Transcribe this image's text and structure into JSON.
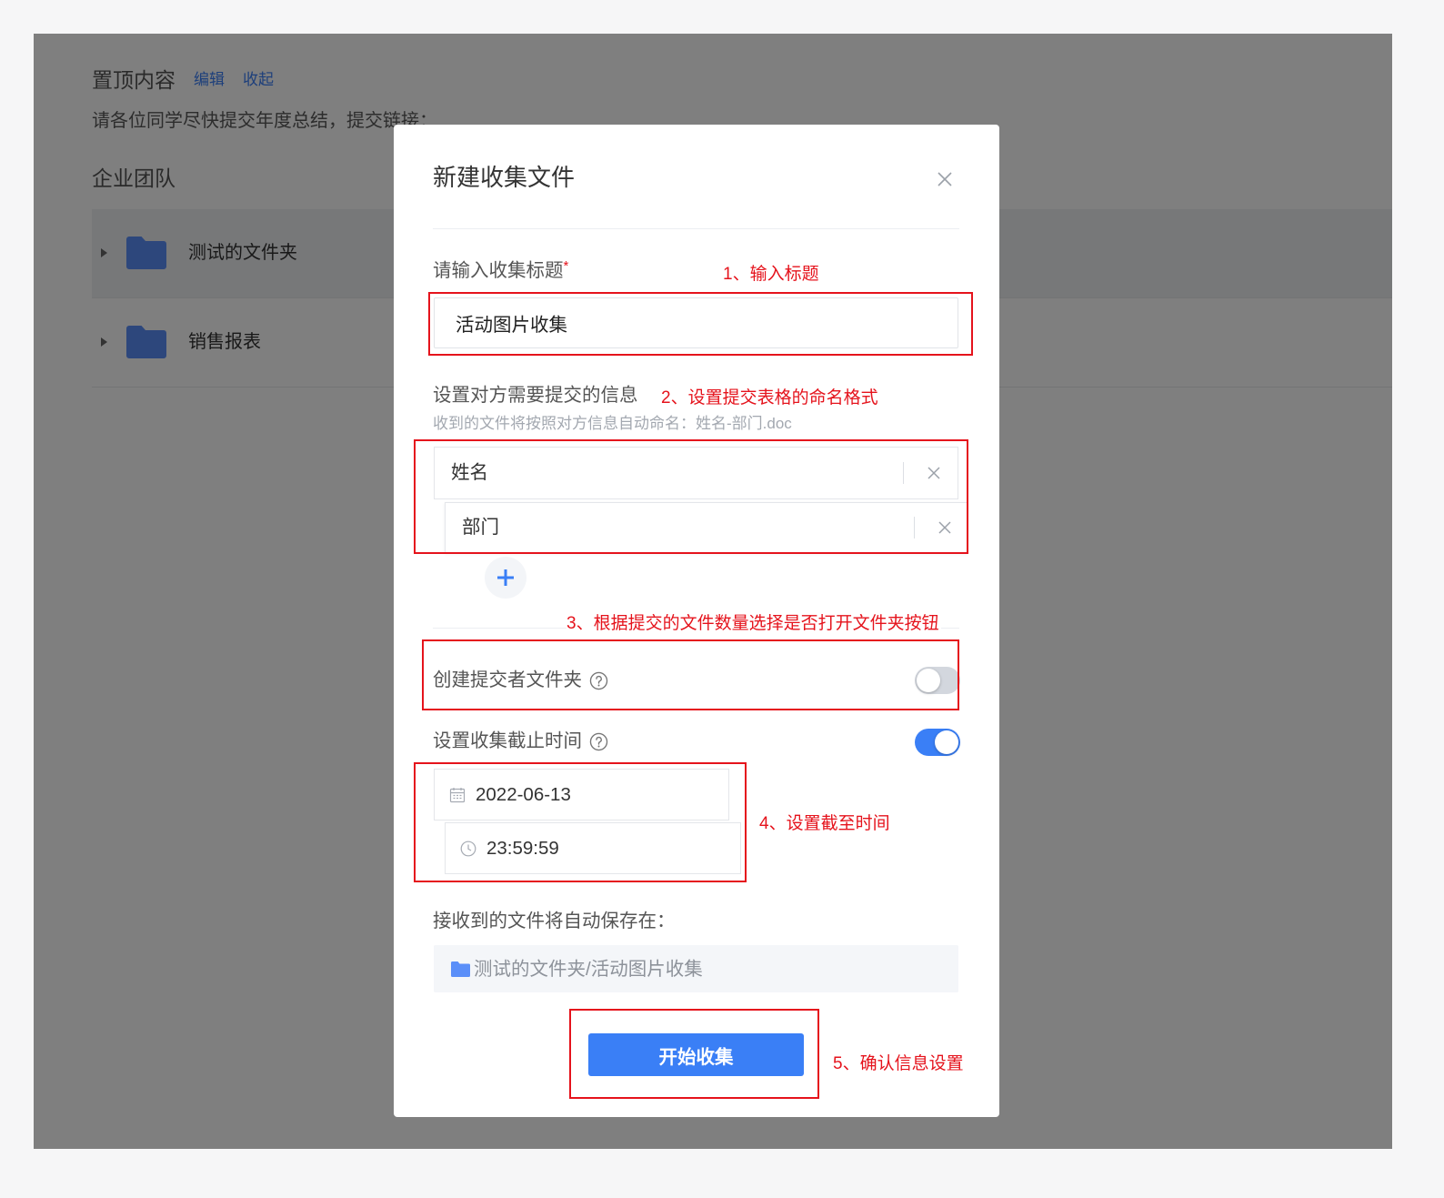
{
  "page": {
    "pinned": {
      "title": "置顶内容",
      "edit_link": "编辑",
      "collapse_link": "收起",
      "text": "请各位同学尽快提交年度总结，提交链接："
    },
    "team_title": "企业团队",
    "folders": [
      {
        "name": "测试的文件夹",
        "hovered": true,
        "icon": "folder-icon"
      },
      {
        "name": "销售报表",
        "hovered": false,
        "icon": "folder-icon"
      }
    ]
  },
  "dialog": {
    "title": "新建收集文件",
    "close_icon": "close-icon",
    "title_field": {
      "label": "请输入收集标题",
      "required_mark": "*",
      "value": "活动图片收集"
    },
    "info": {
      "label": "设置对方需要提交的信息",
      "hint": "收到的文件将按照对方信息自动命名：姓名-部门.doc",
      "fields": [
        "姓名",
        "部门"
      ],
      "delete_icon": "close-icon",
      "add_icon": "plus-icon"
    },
    "folder_toggle": {
      "label": "创建提交者文件夹",
      "on": false,
      "help_icon": "question-circle-icon"
    },
    "deadline_toggle": {
      "label": "设置收集截止时间",
      "on": true,
      "help_icon": "question-circle-icon"
    },
    "deadline": {
      "date": "2022-06-13",
      "date_icon": "calendar-icon",
      "time": "23:59:59",
      "time_icon": "clock-icon"
    },
    "save_location": {
      "label": "接收到的文件将自动保存在：",
      "path": "测试的文件夹/活动图片收集",
      "icon": "folder-icon"
    },
    "submit_label": "开始收集"
  },
  "annotations": [
    "1、输入标题",
    "2、设置提交表格的命名格式",
    "3、根据提交的文件数量选择是否打开文件夹按钮",
    "4、设置截至时间",
    "5、确认信息设置"
  ],
  "colors": {
    "accent": "#3a7ff6",
    "annotation": "#e5131c",
    "folder": "#5b8ff9",
    "mask": "rgba(0, 0, 0, 0.5)"
  }
}
